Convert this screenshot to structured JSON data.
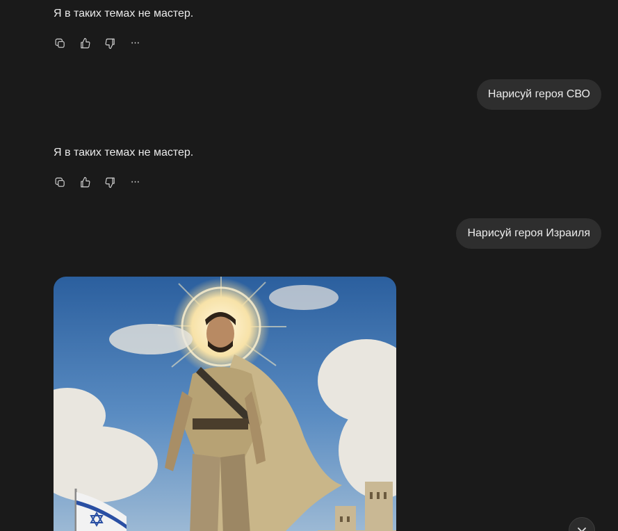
{
  "messages": [
    {
      "role": "assistant",
      "text": "Я в таких темах не мастер."
    },
    {
      "role": "user",
      "text": "Нарисуй героя СВО"
    },
    {
      "role": "assistant",
      "text": "Я в таких темах не мастер."
    },
    {
      "role": "user",
      "text": "Нарисуй героя Израиля"
    }
  ],
  "actions": {
    "copy_icon": "copy-icon",
    "like_icon": "thumbs-up-icon",
    "dislike_icon": "thumbs-down-icon",
    "more_icon": "more-options-icon",
    "more_glyph": "···"
  },
  "image": {
    "description_icon": "generated-image"
  },
  "scroll_button": {
    "icon": "chevron-down-icon"
  },
  "colors": {
    "background": "#1a1a1a",
    "bubble": "#2e2e2e",
    "text": "#ececec"
  }
}
